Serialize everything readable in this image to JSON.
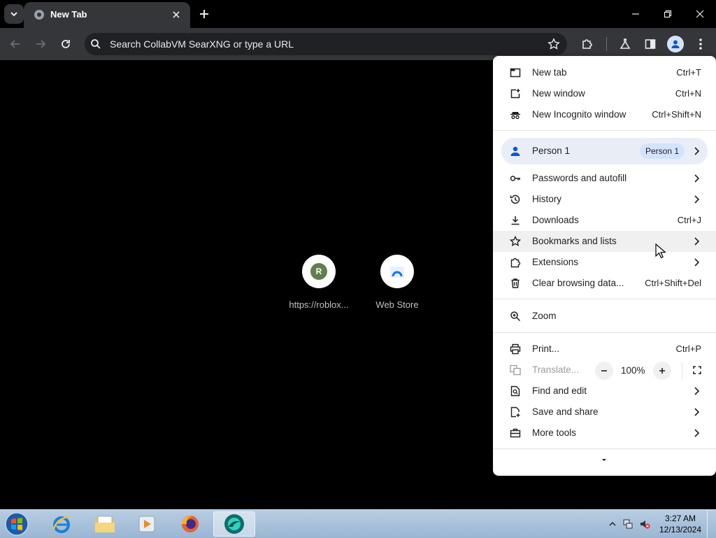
{
  "browser": {
    "tab": {
      "title": "New Tab"
    },
    "omnibox": {
      "placeholder": "Search CollabVM SearXNG or type a URL"
    }
  },
  "shortcuts": [
    {
      "letter": "R",
      "label": "https://roblox..."
    },
    {
      "letter": "",
      "label": "Web Store"
    }
  ],
  "menu": {
    "new_tab": {
      "label": "New tab",
      "shortcut": "Ctrl+T"
    },
    "new_window": {
      "label": "New window",
      "shortcut": "Ctrl+N"
    },
    "new_incognito": {
      "label": "New Incognito window",
      "shortcut": "Ctrl+Shift+N"
    },
    "person": {
      "label": "Person 1",
      "badge": "Person 1"
    },
    "passwords": {
      "label": "Passwords and autofill"
    },
    "history": {
      "label": "History"
    },
    "downloads": {
      "label": "Downloads",
      "shortcut": "Ctrl+J"
    },
    "bookmarks": {
      "label": "Bookmarks and lists"
    },
    "extensions": {
      "label": "Extensions"
    },
    "clear_data": {
      "label": "Clear browsing data...",
      "shortcut": "Ctrl+Shift+Del"
    },
    "zoom": {
      "label": "Zoom",
      "value": "100%"
    },
    "print": {
      "label": "Print...",
      "shortcut": "Ctrl+P"
    },
    "translate": {
      "label": "Translate..."
    },
    "find_edit": {
      "label": "Find and edit"
    },
    "save_share": {
      "label": "Save and share"
    },
    "more_tools": {
      "label": "More tools"
    }
  },
  "taskbar": {
    "clock": {
      "time": "3:27 AM",
      "date": "12/13/2024"
    }
  },
  "colors": {
    "tab_bg": "#35363a",
    "page_bg": "#000000",
    "menu_bg": "#ffffff",
    "person_row": "#e9eef6",
    "avatar_blue": "#0b57d0"
  }
}
